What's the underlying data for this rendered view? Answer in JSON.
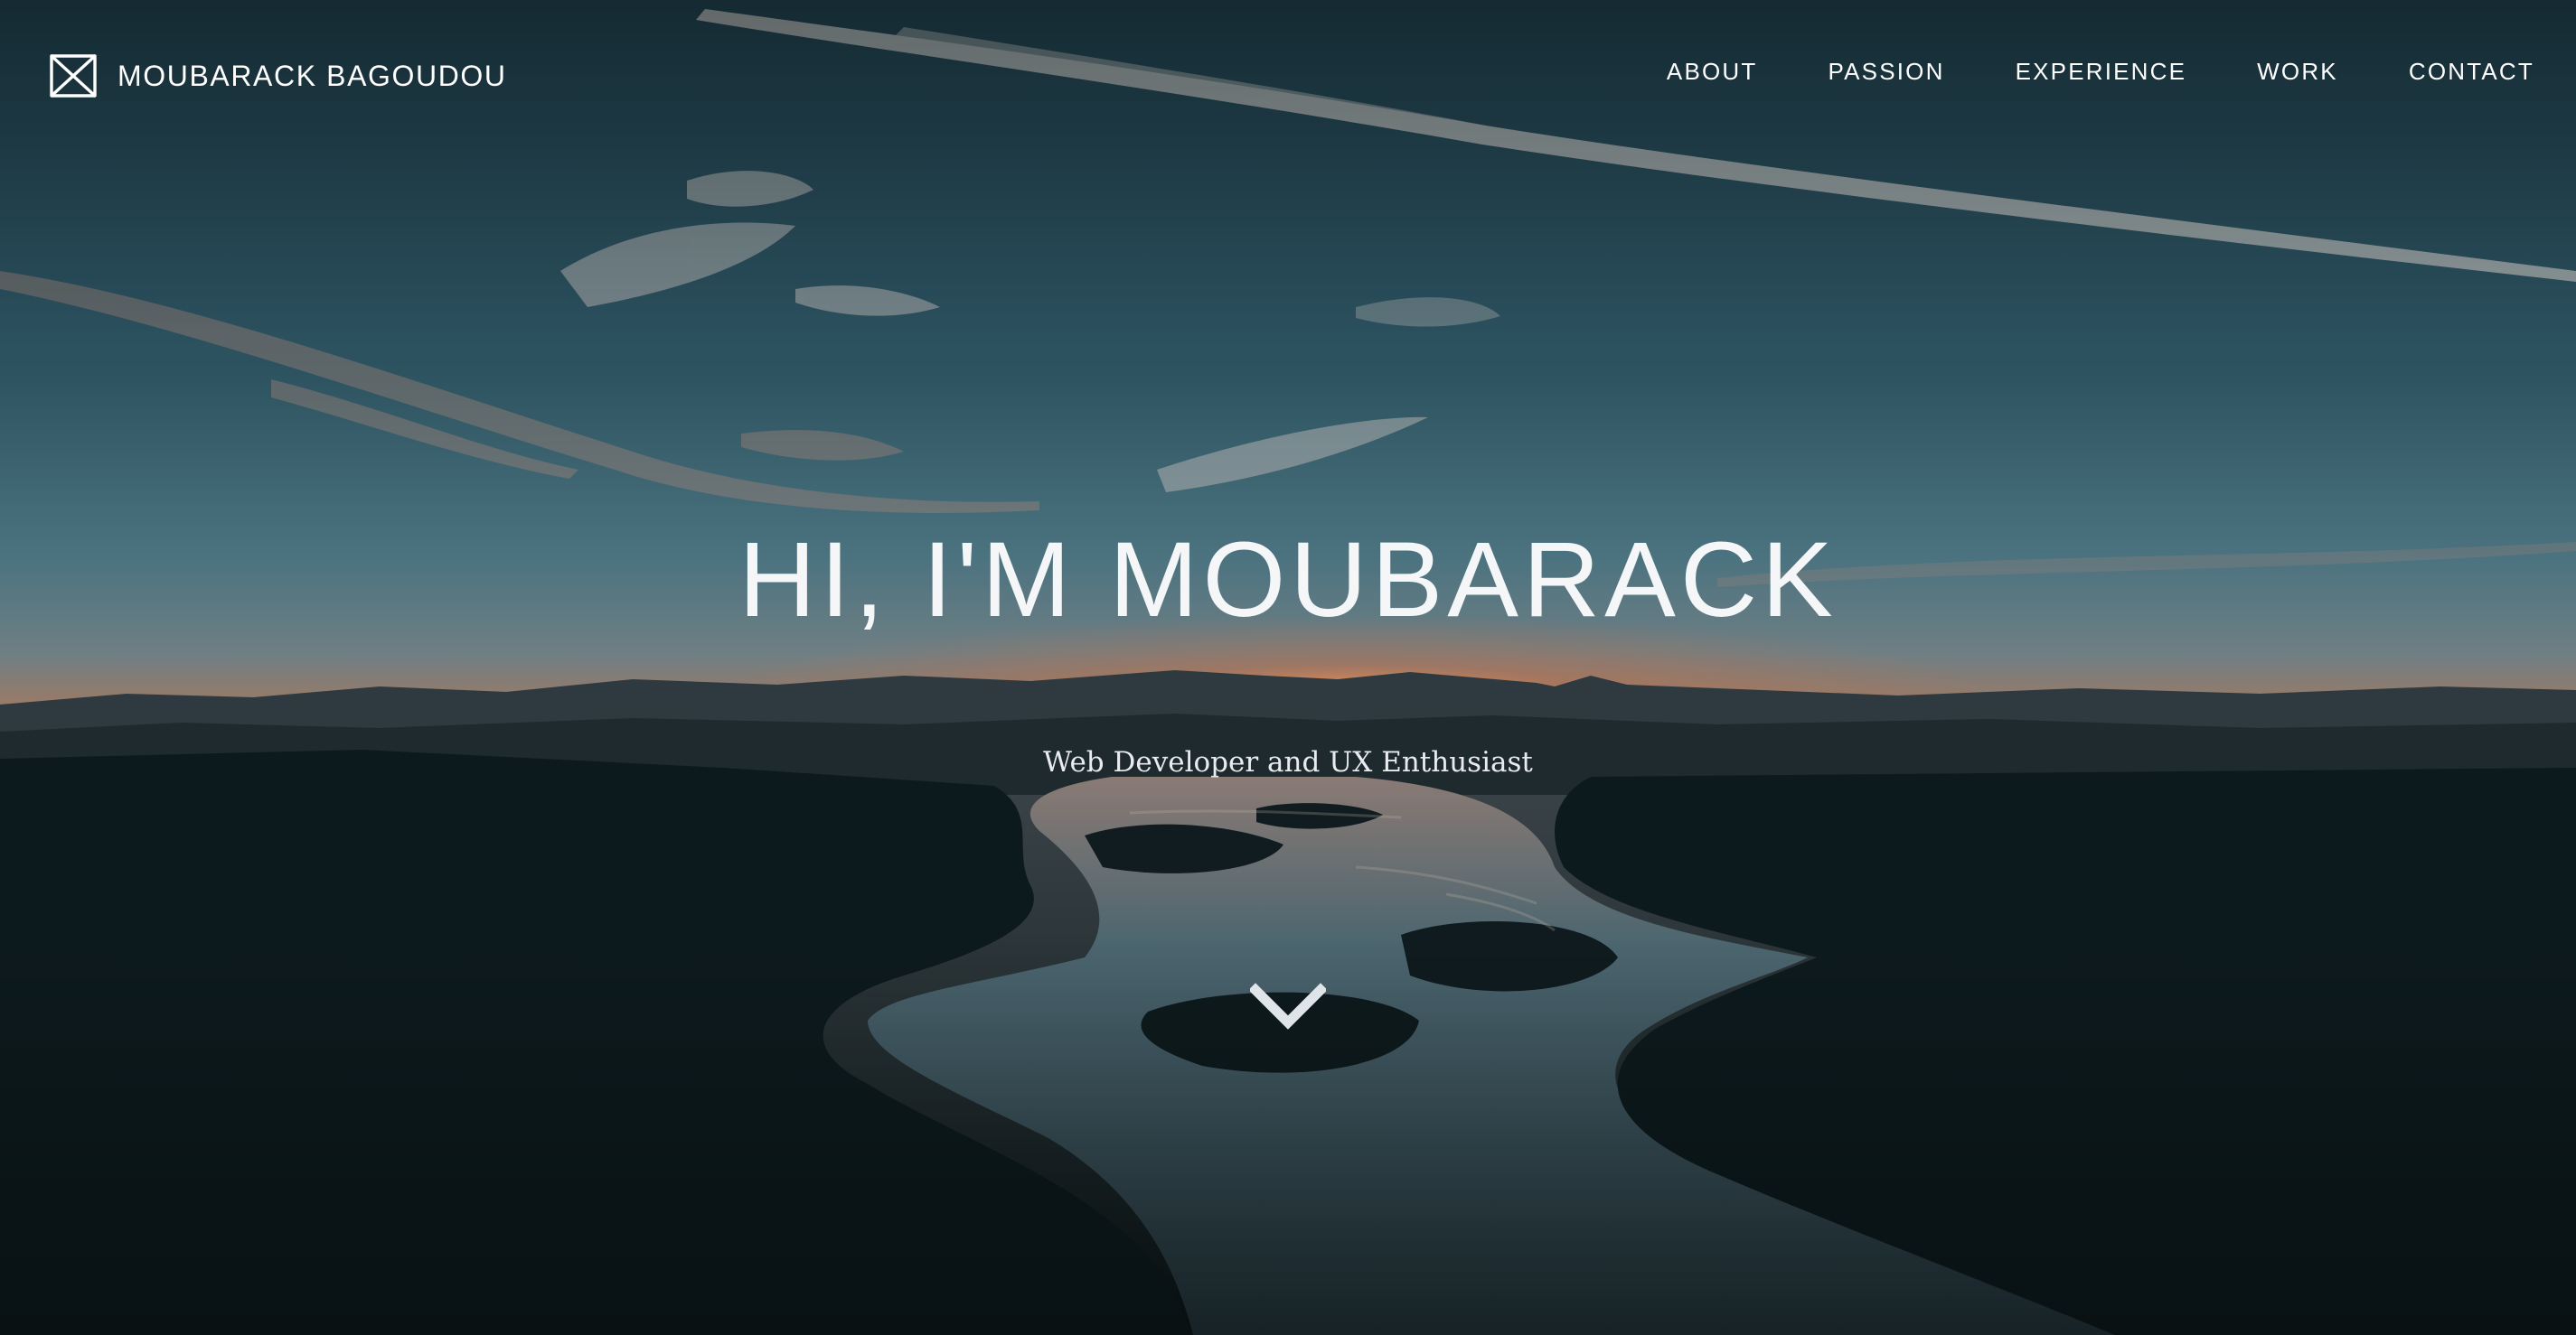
{
  "brand": {
    "name": "MOUBARACK BAGOUDOU",
    "logo_icon": "bowtie-monogram-icon"
  },
  "nav": {
    "items": [
      {
        "label": "ABOUT"
      },
      {
        "label": "PASSION"
      },
      {
        "label": "EXPERIENCE"
      },
      {
        "label": "WORK"
      },
      {
        "label": "CONTACT"
      }
    ]
  },
  "hero": {
    "headline": "HI, I'M MOUBARACK",
    "tagline": "Web Developer and UX Enthusiast",
    "scroll_icon": "chevron-down-icon",
    "background": "sunset-over-river-landscape-photo"
  },
  "colors": {
    "text": "#ffffff",
    "sky_top": "#1f3e4b",
    "sky_mid": "#4e7580",
    "horizon_glow": "#e07a45",
    "land_dark": "#0c1719"
  }
}
